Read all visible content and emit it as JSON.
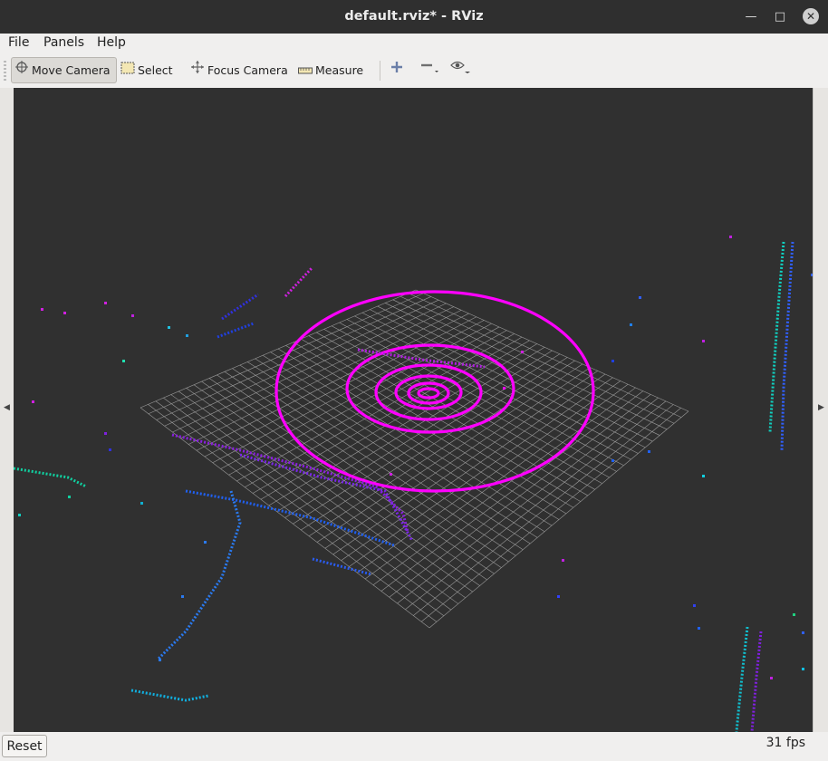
{
  "window": {
    "title": "default.rviz* - RViz"
  },
  "menu": {
    "items": [
      "File",
      "Panels",
      "Help"
    ]
  },
  "toolbar": {
    "move_camera": "Move Camera",
    "select": "Select",
    "focus_camera": "Focus Camera",
    "measure": "Measure"
  },
  "status": {
    "reset": "Reset",
    "fps": "31 fps"
  },
  "colors": {
    "accent_magenta": "#ff00ff",
    "grid": "#a0a0a0",
    "viewport_bg": "#303030"
  }
}
